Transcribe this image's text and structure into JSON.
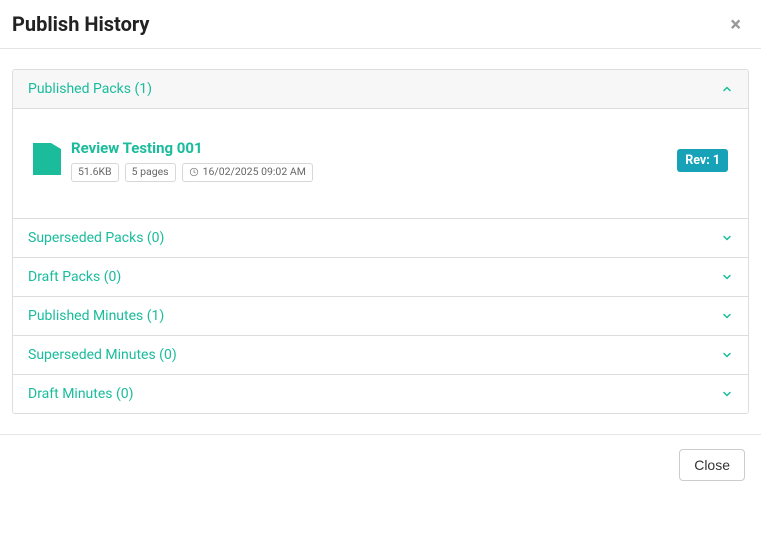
{
  "header": {
    "title": "Publish History"
  },
  "accent_color": "#1abc9c",
  "badge_color": "#17a2b8",
  "sections": [
    {
      "label": "Published Packs (1)",
      "expanded": true
    },
    {
      "label": "Superseded Packs (0)",
      "expanded": false
    },
    {
      "label": "Draft Packs (0)",
      "expanded": false
    },
    {
      "label": "Published Minutes (1)",
      "expanded": false
    },
    {
      "label": "Superseded Minutes (0)",
      "expanded": false
    },
    {
      "label": "Draft Minutes (0)",
      "expanded": false
    }
  ],
  "document": {
    "title": "Review Testing 001",
    "size": "51.6KB",
    "pages": "5 pages",
    "timestamp": "16/02/2025 09:02 AM",
    "revision": "Rev: 1"
  },
  "footer": {
    "close_label": "Close"
  }
}
